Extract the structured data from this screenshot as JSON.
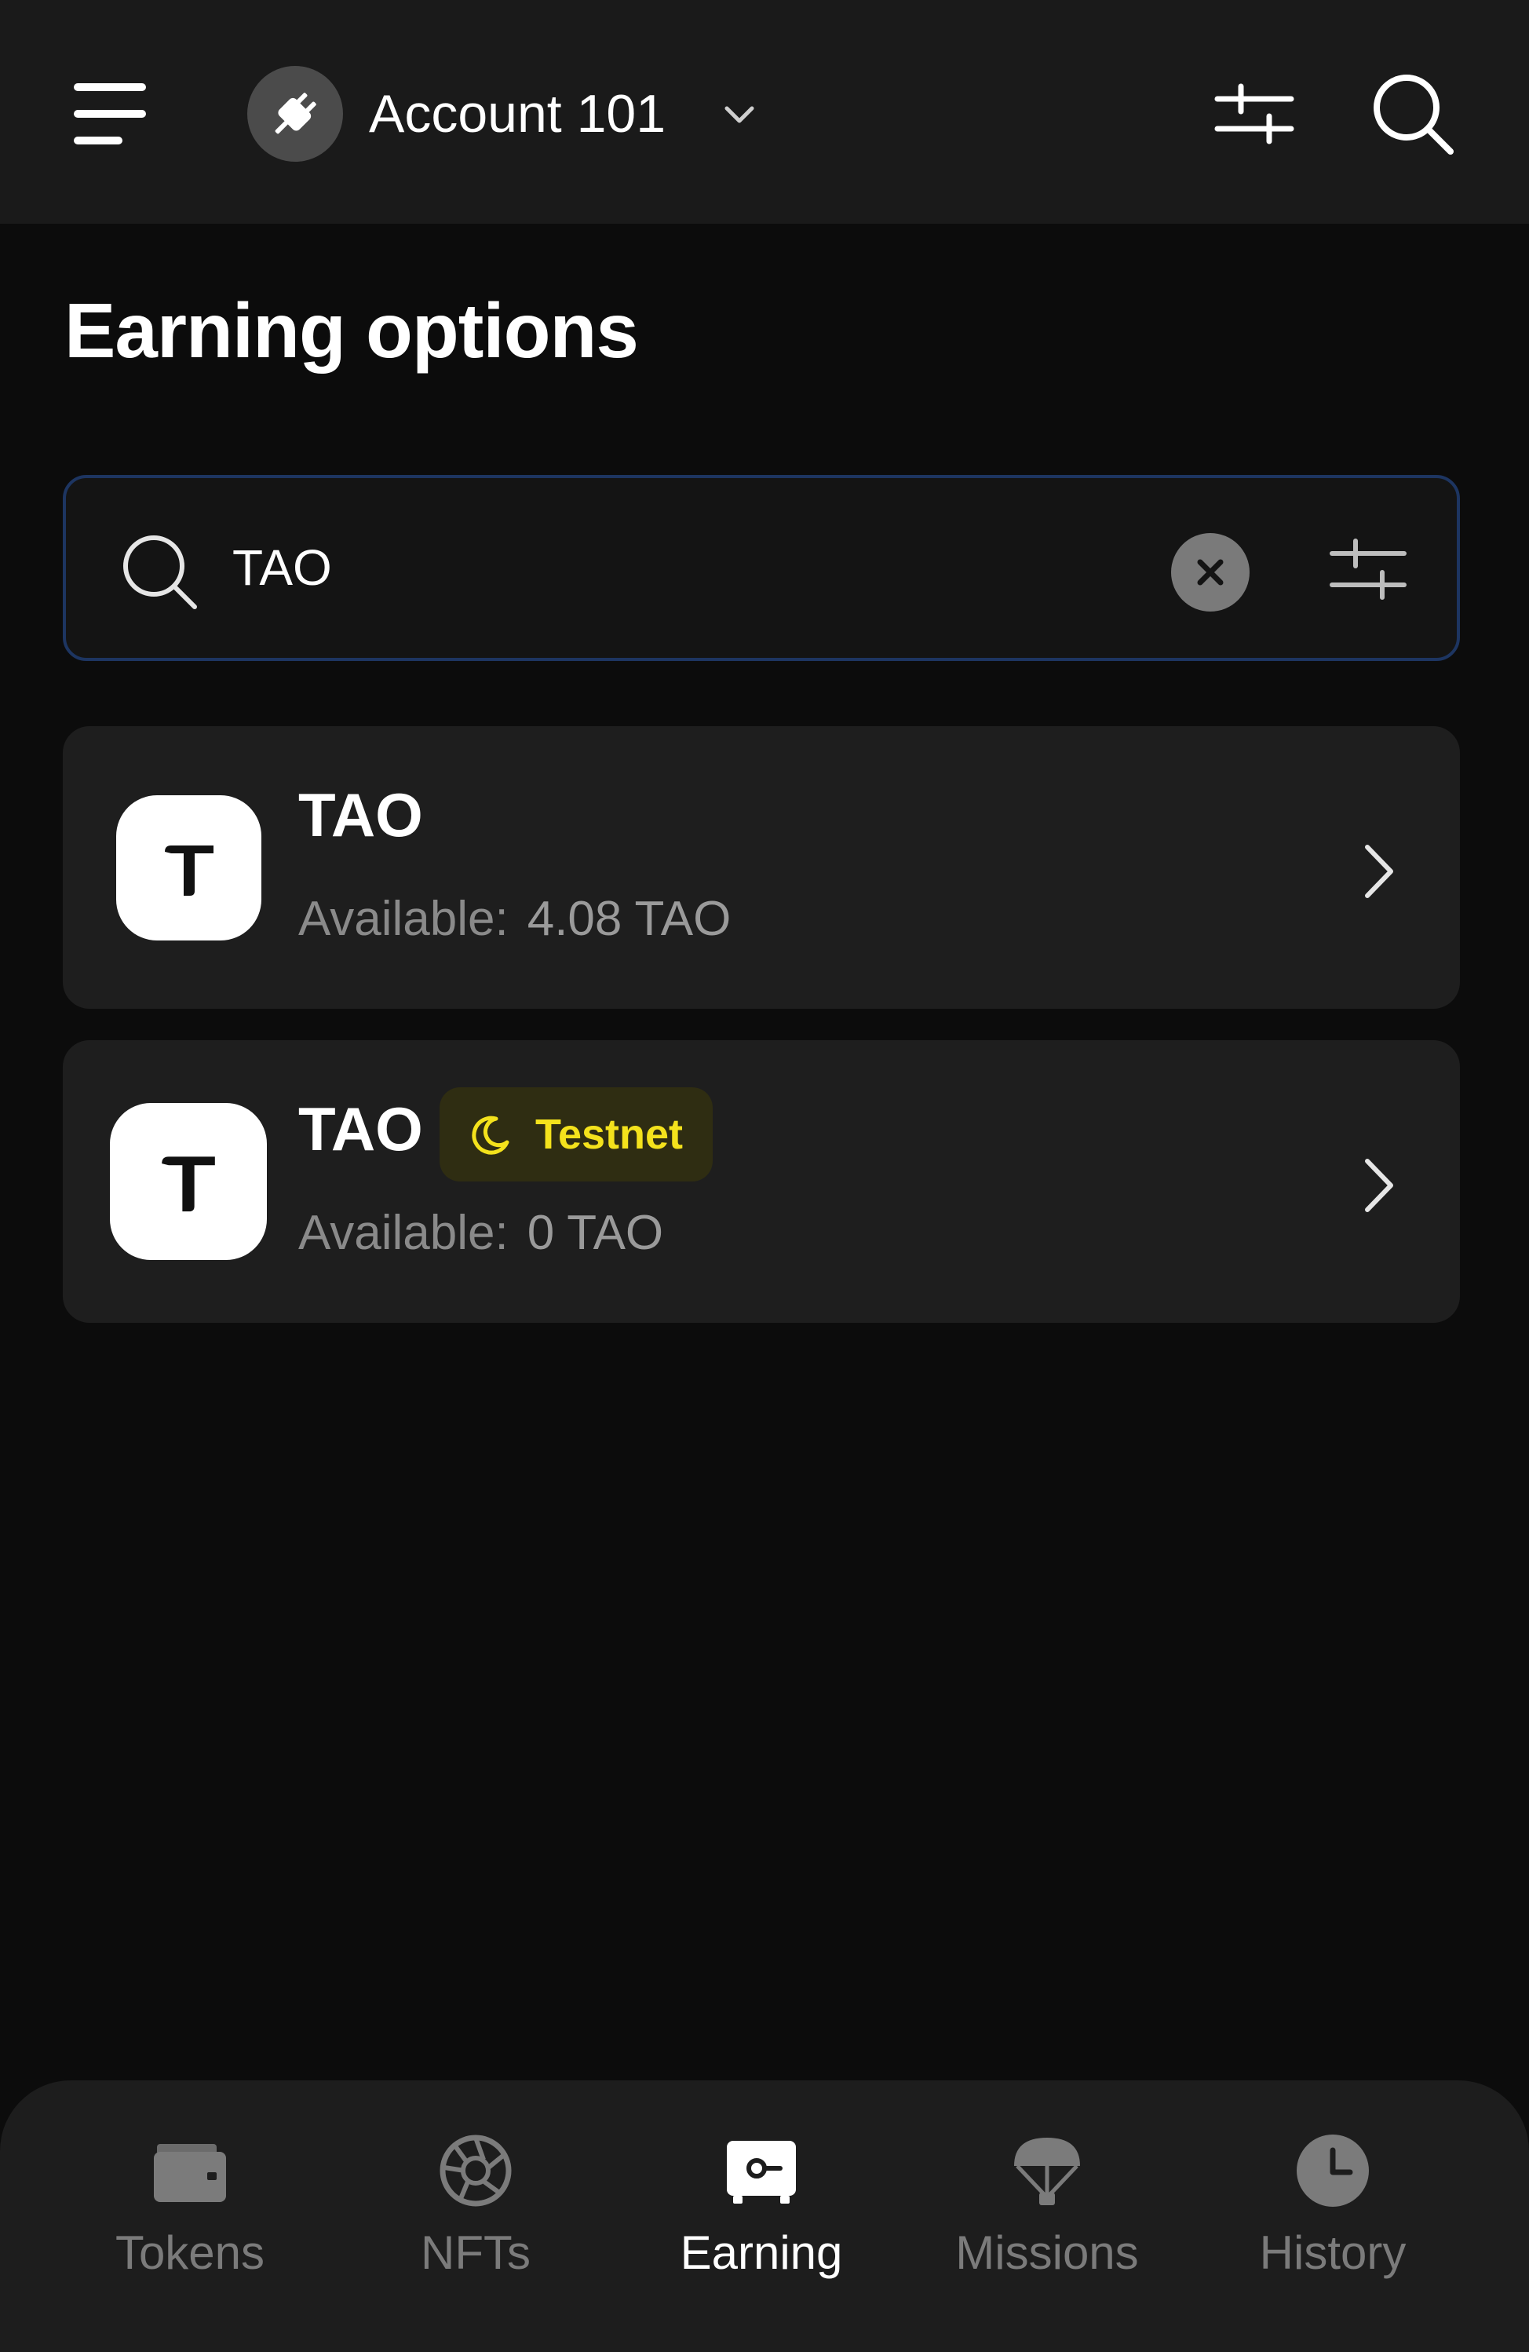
{
  "header": {
    "account_name": "Account 101",
    "icons": {
      "menu": "menu-icon",
      "account": "plug-icon",
      "chevron": "chevron-down-icon",
      "filter": "sliders-icon",
      "search": "search-icon"
    }
  },
  "page": {
    "title": "Earning options"
  },
  "search": {
    "value": "TAO",
    "placeholder": ""
  },
  "earning_options": [
    {
      "symbol": "TAO",
      "available_label": "Available:",
      "available_value": "4.08 TAO",
      "badge": null
    },
    {
      "symbol": "TAO",
      "available_label": "Available:",
      "available_value": "0 TAO",
      "badge": "Testnet"
    }
  ],
  "bottom_nav": {
    "items": [
      {
        "label": "Tokens",
        "icon": "wallet-icon",
        "active": false
      },
      {
        "label": "NFTs",
        "icon": "aperture-icon",
        "active": false
      },
      {
        "label": "Earning",
        "icon": "safe-icon",
        "active": true
      },
      {
        "label": "Missions",
        "icon": "parachute-icon",
        "active": false
      },
      {
        "label": "History",
        "icon": "clock-icon",
        "active": false
      }
    ]
  },
  "colors": {
    "background": "#0c0c0c",
    "header": "#1a1a1a",
    "card": "#1e1e1e",
    "search_border": "#1d3561",
    "badge_bg": "#2f2d12",
    "badge_text": "#f4e21c",
    "muted_text": "#8a8a8a"
  }
}
